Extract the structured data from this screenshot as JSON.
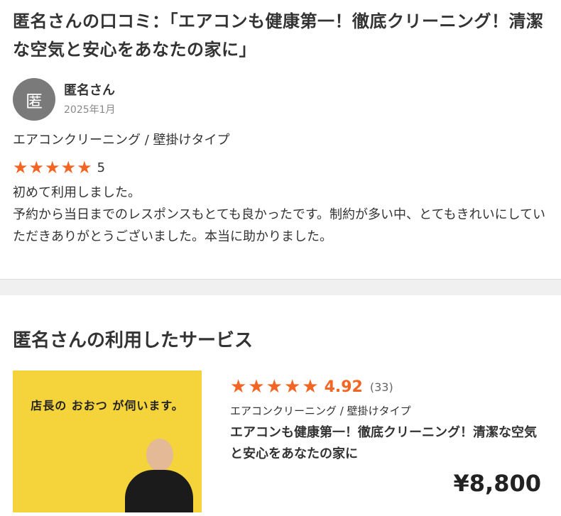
{
  "review": {
    "title": "匿名さんの口コミ：「エアコンも健康第一！徹底クリーニング！清潔な空気と安心をあなたの家に」",
    "avatar_char": "匿",
    "user_name": "匿名さん",
    "date": "2025年1月",
    "category": "エアコンクリーニング / 壁掛けタイプ",
    "rating": 5,
    "rating_text": "5",
    "comment": "初めて利用しました。\n予約から当日までのレスポンスもとても良かったです。制約が多い中、とてもきれいにしていただきありがとうございました。本当に助かりました。"
  },
  "service": {
    "heading": "匿名さんの利用したサービス",
    "thumb_caption": "店長の おおつ が伺います。",
    "rating": 4.92,
    "rating_text": "4.92",
    "review_count": "(33)",
    "category": "エアコンクリーニング / 壁掛けタイプ",
    "title": "エアコンも健康第一！徹底クリーニング！清潔な空気と安心をあなたの家に",
    "price": "¥8,800"
  },
  "colors": {
    "star": "#f26522",
    "thumb_bg": "#f5d33a"
  },
  "icons": {
    "star": "star-icon"
  }
}
